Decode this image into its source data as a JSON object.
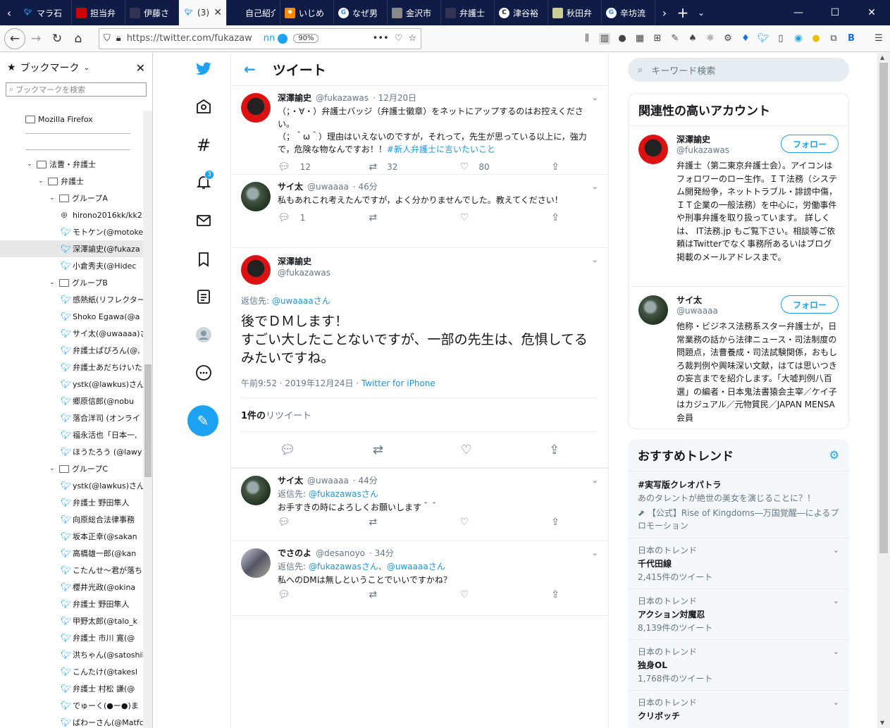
{
  "tabs": [
    {
      "icon": "twitter-icon",
      "color": "#1da1f2",
      "label": "マラ石"
    },
    {
      "icon": "fri-icon",
      "color": "#c00",
      "label": "担当弁"
    },
    {
      "icon": "bj-icon",
      "color": "#335",
      "label": "伊藤さ"
    },
    {
      "icon": "twitter-icon",
      "color": "#1da1f2",
      "label": "(3)",
      "active": true
    },
    {
      "icon": "none",
      "color": "#fff",
      "label": "自己紹介"
    },
    {
      "icon": "star-icon",
      "color": "#f80",
      "label": "いじめ"
    },
    {
      "icon": "google-icon",
      "color": "#fff",
      "label": "なぜ男"
    },
    {
      "icon": "kanazawa-icon",
      "color": "#888",
      "label": "金沢市"
    },
    {
      "icon": "bengoshi-icon",
      "color": "#335",
      "label": "弁護士"
    },
    {
      "icon": "c-icon",
      "color": "#fff",
      "label": "津谷裕"
    },
    {
      "icon": "akita-icon",
      "color": "#cc9",
      "label": "秋田弁"
    },
    {
      "icon": "google-icon",
      "color": "#fff",
      "label": "辛坊流"
    }
  ],
  "nav": {
    "url": "https://twitter.com/fukazaw",
    "ext_label": "nn",
    "zoom": "90%"
  },
  "sidebar": {
    "title": "ブックマーク",
    "search_placeholder": "ブックマークを検索",
    "items": [
      {
        "type": "folder",
        "indent": 0,
        "label": "Mozilla Firefox"
      },
      {
        "type": "sep"
      },
      {
        "type": "blank"
      },
      {
        "type": "sep"
      },
      {
        "type": "folder",
        "indent": 1,
        "open": true,
        "label": "法曹・弁護士"
      },
      {
        "type": "folder",
        "indent": 2,
        "open": true,
        "label": "弁護士"
      },
      {
        "type": "folder",
        "indent": 3,
        "open": true,
        "label": "グループA"
      },
      {
        "type": "globe",
        "indent": 4,
        "label": "hirono2016kk/kk2"
      },
      {
        "type": "tw",
        "indent": 4,
        "label": "モトケン(@motoken"
      },
      {
        "type": "tw",
        "indent": 4,
        "label": "深澤諭史(@fukaza",
        "selected": true
      },
      {
        "type": "tw",
        "indent": 4,
        "label": "小倉秀夫(@Hidec"
      },
      {
        "type": "folder",
        "indent": 3,
        "open": true,
        "label": "グループB"
      },
      {
        "type": "tw",
        "indent": 4,
        "label": "感熱紙(リフレクター,"
      },
      {
        "type": "tw",
        "indent": 4,
        "label": "Shoko Egawa(@a"
      },
      {
        "type": "tw",
        "indent": 4,
        "label": "サイ太(@uwaaaa)さ"
      },
      {
        "type": "tw",
        "indent": 4,
        "label": "弁護士ぱぴろん(@,"
      },
      {
        "type": "tw",
        "indent": 4,
        "label": "弁護士あだちけいた"
      },
      {
        "type": "tw",
        "indent": 4,
        "label": "ystk(@lawkus)さん"
      },
      {
        "type": "tw",
        "indent": 4,
        "label": "郷原信郎(@nobu"
      },
      {
        "type": "tw",
        "indent": 4,
        "label": "落合洋司 (オンライ"
      },
      {
        "type": "tw",
        "indent": 4,
        "label": "福永活也「日本一,"
      },
      {
        "type": "tw",
        "indent": 4,
        "label": "ほうたろう (@lawy"
      },
      {
        "type": "folder",
        "indent": 3,
        "open": true,
        "label": "グループC"
      },
      {
        "type": "tw",
        "indent": 4,
        "label": "ystk(@lawkus)さん"
      },
      {
        "type": "tw",
        "indent": 4,
        "label": "弁護士 野田隼人"
      },
      {
        "type": "tw",
        "indent": 4,
        "label": "向原総合法律事務"
      },
      {
        "type": "tw",
        "indent": 4,
        "label": "坂本正幸(@sakan"
      },
      {
        "type": "tw",
        "indent": 4,
        "label": "高橋雄一郎(@kan"
      },
      {
        "type": "tw",
        "indent": 4,
        "label": "こたんせ〜君が落ち"
      },
      {
        "type": "tw",
        "indent": 4,
        "label": "櫻井光政(@okina"
      },
      {
        "type": "tw",
        "indent": 4,
        "label": "弁護士 野田隼人"
      },
      {
        "type": "tw",
        "indent": 4,
        "label": "甲野太郎(@talo_k"
      },
      {
        "type": "tw",
        "indent": 4,
        "label": "弁護士 市川 寛(@"
      },
      {
        "type": "tw",
        "indent": 4,
        "label": "洪ちゃん(@satoshil"
      },
      {
        "type": "tw",
        "indent": 4,
        "label": "こんたけ(@takesl"
      },
      {
        "type": "tw",
        "indent": 4,
        "label": "弁護士 村松 謙(@"
      },
      {
        "type": "tw",
        "indent": 4,
        "label": "でゅーく(●ー●)ま"
      },
      {
        "type": "tw",
        "indent": 4,
        "label": "ばわーさん(@Matfc"
      }
    ]
  },
  "twnav": {
    "notif_count": "3"
  },
  "main": {
    "title": "ツイート",
    "t1": {
      "name": "深澤諭史",
      "handle": "@fukazawas",
      "time": "· 12月20日",
      "line1": "（；・∀・）弁護士バッジ（弁護士徽章）をネットにアップするのはお控えください。",
      "line2": "（；＾ω＾）理由はいえないのですが，それって，先生が思っている以上に，強力で，危険な物なんですお！！",
      "hashtag": "#新人弁護士に言いたいこと",
      "replies": "12",
      "retweets": "32",
      "likes": "80"
    },
    "t2": {
      "name": "サイ太",
      "handle": "@uwaaaa",
      "time": "· 46分",
      "text": "私もあれこれ考えたんですが，よく分かりませんでした。教えてください！",
      "replies": "1"
    },
    "focus": {
      "name": "深澤諭史",
      "handle": "@fukazawas",
      "reply_prefix": "返信先: ",
      "reply_to": "@uwaaaaさん",
      "text": "後でＤＭします！\nすごい大したことないですが、一部の先生は、危惧してるみたいですね。",
      "datetime": "午前9:52 · 2019年12月24日 · ",
      "client": "Twitter for iPhone",
      "rt_count": "1件の",
      "rt_label": "リツイート"
    },
    "t3": {
      "name": "サイ太",
      "handle": "@uwaaaa",
      "time": "· 44分",
      "reply_prefix": "返信先: ",
      "reply_to": "@fukazawasさん",
      "text": "お手すきの時によろしくお願いします＾＾"
    },
    "t4": {
      "name": "でさのよ",
      "handle": "@desanoyo",
      "time": "· 34分",
      "reply_prefix": "返信先: ",
      "reply_to1": "@fukazawasさん",
      "reply_sep": "、",
      "reply_to2": "@uwaaaaさん",
      "text": "私へのDMは無しということでいいですかね？"
    }
  },
  "right": {
    "search_placeholder": "キーワード検索",
    "rel_title": "関連性の高いアカウント",
    "follow_label": "フォロー",
    "accounts": [
      {
        "name": "深澤諭史",
        "handle": "@fukazawas",
        "bio": "弁護士（第二東京弁護士会）。アイコンはフォロワーのロー生作。ＩＴ法務（システム開発紛争，ネットトラブル・誹謗中傷，ＩＴ企業の一般法務）を中心に，労働事件や刑事弁護を取り扱っています。 詳しくは、 IT法務.jp もご覧下さい。相談等ご依頼はTwitterでなく事務所あるいはブログ掲載のメールアドレスまで。"
      },
      {
        "name": "サイ太",
        "handle": "@uwaaaa",
        "bio": "他称・ビジネス法務系スター弁護士が，日常業務の話から法律ニュース・司法制度の問題点，法曹養成・司法試験関係，おもしろ裁判例や興味深い文献，はては思いつきの妄言までを紹介します。「大嘘判例八百選」の編者・日本鬼法書猿会主宰／ケイ子はカジュアル／元物質民／JAPAN MENSA会員"
      }
    ],
    "trend_title": "おすすめトレンド",
    "trends": [
      {
        "name": "#実写版クレオパトラ",
        "desc": "あのタレントが絶世の美女を演じることに？！",
        "promo": "【公式】Rise of Kingdoms―万国覚醒―によるプロモーション"
      },
      {
        "cat": "日本のトレンド",
        "name": "千代田線",
        "count": "2,415件のツイート"
      },
      {
        "cat": "日本のトレンド",
        "name": "アクション対魔忍",
        "count": "8,139件のツイート"
      },
      {
        "cat": "日本のトレンド",
        "name": "独身OL",
        "count": "1,768件のツイート"
      },
      {
        "cat": "日本のトレンド",
        "name": "クリボッチ",
        "count": ""
      }
    ]
  }
}
